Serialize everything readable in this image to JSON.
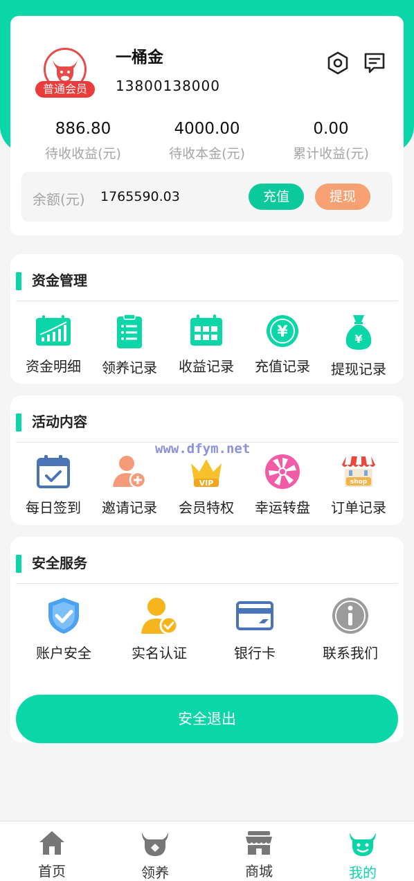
{
  "profile": {
    "username": "一桶金",
    "phone": "13800138000",
    "level_badge": "普通会员",
    "icons": [
      "settings-icon",
      "message-icon",
      "bull-logo-icon"
    ]
  },
  "stats": [
    {
      "value": "886.80",
      "label": "待收收益(元)"
    },
    {
      "value": "4000.00",
      "label": "待收本金(元)"
    },
    {
      "value": "0.00",
      "label": "累计收益(元)"
    }
  ],
  "balance": {
    "label": "余额(元)",
    "value": "1765590.03",
    "recharge_label": "充值",
    "withdraw_label": "提现"
  },
  "funds": {
    "title": "资金管理",
    "items": [
      {
        "label": "资金明细",
        "icon": "chart-icon"
      },
      {
        "label": "领养记录",
        "icon": "clipboard-icon"
      },
      {
        "label": "收益记录",
        "icon": "calendar-icon"
      },
      {
        "label": "充值记录",
        "icon": "yen-coin-icon"
      },
      {
        "label": "提现记录",
        "icon": "money-bag-icon"
      }
    ]
  },
  "activity": {
    "title": "活动内容",
    "items": [
      {
        "label": "每日签到",
        "icon": "checkin-calendar-icon"
      },
      {
        "label": "邀请记录",
        "icon": "add-user-icon"
      },
      {
        "label": "会员特权",
        "icon": "vip-crown-icon"
      },
      {
        "label": "幸运转盘",
        "icon": "wheel-icon"
      },
      {
        "label": "订单记录",
        "icon": "shop-icon"
      }
    ]
  },
  "watermark": "www.dfym.net",
  "security": {
    "title": "安全服务",
    "items": [
      {
        "label": "账户安全",
        "icon": "shield-check-icon"
      },
      {
        "label": "实名认证",
        "icon": "verified-user-icon"
      },
      {
        "label": "银行卡",
        "icon": "bank-card-icon"
      },
      {
        "label": "联系我们",
        "icon": "info-icon"
      }
    ]
  },
  "logout_label": "安全退出",
  "tabs": [
    {
      "label": "首页",
      "icon": "home-icon"
    },
    {
      "label": "领养",
      "icon": "bull-icon"
    },
    {
      "label": "商城",
      "icon": "store-icon"
    },
    {
      "label": "我的",
      "icon": "profile-bull-icon",
      "active": true
    }
  ],
  "colors": {
    "accent": "#0bd6a8",
    "recharge": "#0bc99a",
    "withdraw": "#f6a073",
    "badge": "#ec3b3b"
  }
}
